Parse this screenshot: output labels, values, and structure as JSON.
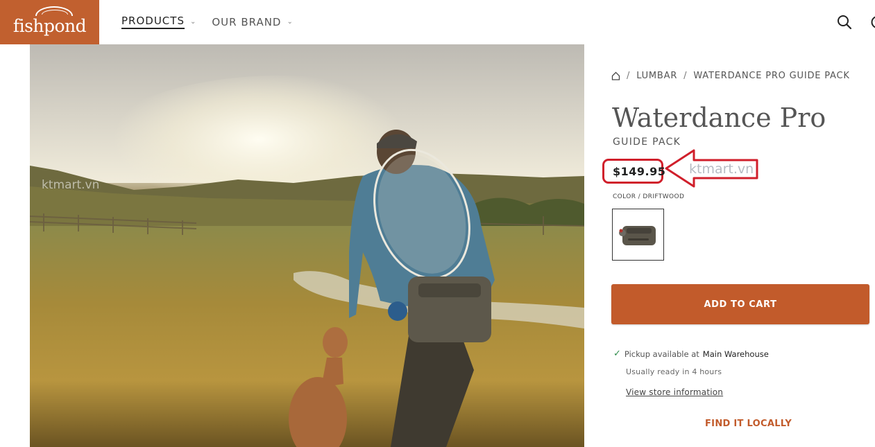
{
  "brand": {
    "logo_text": "fishpond",
    "accent": "#c1602f"
  },
  "nav": {
    "items": [
      {
        "label": "PRODUCTS",
        "active": true
      },
      {
        "label": "OUR BRAND",
        "active": false
      }
    ],
    "icons": [
      "search-icon",
      "account-icon"
    ]
  },
  "hero": {
    "watermark": "ktmart.vn",
    "description_icon": "product-lifestyle-photo"
  },
  "breadcrumb": {
    "home_icon": "home-icon",
    "separator": "/",
    "items": [
      "LUMBAR",
      "WATERDANCE PRO GUIDE PACK"
    ]
  },
  "product": {
    "title": "Waterdance Pro",
    "subtitle": "GUIDE PACK",
    "price": "$149.95",
    "color_label": "COLOR / DRIFTWOOD",
    "swatch_icon": "driftwood-pack-thumbnail"
  },
  "annotation": {
    "watermark": "ktmart.vn",
    "color": "#d01f2b"
  },
  "actions": {
    "add_to_cart": "ADD TO CART",
    "pickup_prefix": "Pickup available at",
    "pickup_location": "Main Warehouse",
    "ready_text": "Usually ready in 4 hours",
    "store_info_link": "View store information",
    "find_locally": "FIND IT LOCALLY"
  }
}
